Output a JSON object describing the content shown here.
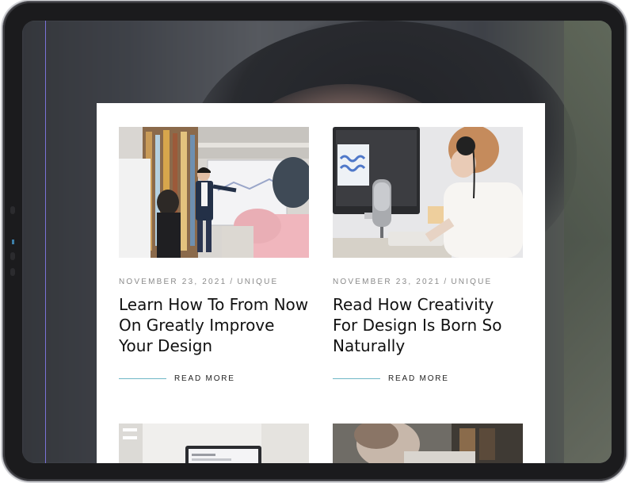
{
  "posts": [
    {
      "date": "NOVEMBER 23, 2021",
      "separator": "/",
      "category": "UNIQUE",
      "title": "Learn How To From Now On Greatly Improve Your Design",
      "read_more": "READ MORE",
      "image": "presentation-photo"
    },
    {
      "date": "NOVEMBER 23, 2021",
      "separator": "/",
      "category": "UNIQUE",
      "title": "Read How Creativity For Design Is Born So Naturally",
      "read_more": "READ MORE",
      "image": "audio-editing-photo"
    }
  ],
  "next_row_images": [
    "laptop-desk-photo",
    "reading-person-photo"
  ],
  "colors": {
    "accent_line": "#6fb7c6",
    "meta_text": "#8a8a8a",
    "title_text": "#111111",
    "device_frame": "#1b1b1d",
    "guide_line": "#7a72d8"
  }
}
